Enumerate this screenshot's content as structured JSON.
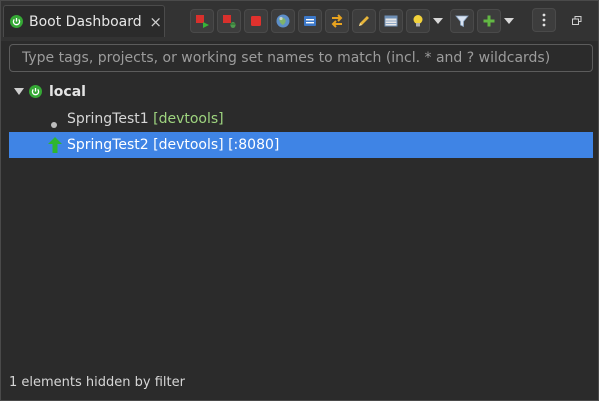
{
  "view": {
    "title": "Boot Dashboard",
    "close_glyph": "×"
  },
  "toolbar": {
    "buttons": [
      {
        "name": "start-button",
        "icon": "start-icon"
      },
      {
        "name": "debug-button",
        "icon": "debug-icon"
      },
      {
        "name": "stop-button",
        "icon": "stop-icon"
      },
      {
        "name": "open-browser-button",
        "icon": "globe-icon"
      },
      {
        "name": "open-console-button",
        "icon": "console-icon"
      },
      {
        "name": "refresh-button",
        "icon": "refresh-arrows-icon"
      },
      {
        "name": "edit-button",
        "icon": "pencil-icon"
      },
      {
        "name": "properties-button",
        "icon": "table-icon"
      },
      {
        "name": "live-hover-button",
        "icon": "lightbulb-icon"
      },
      {
        "name": "filter-button",
        "icon": "funnel-icon"
      },
      {
        "name": "add-target-button",
        "icon": "plus-icon"
      }
    ],
    "menu_icon": "vertical-dots-icon",
    "restore_icon": "restore-window-icon"
  },
  "filter": {
    "placeholder": "Type tags, projects, or working set names to match (incl. * and ? wildcards)",
    "value": ""
  },
  "tree": {
    "group": {
      "label": "local",
      "expanded": true
    },
    "items": [
      {
        "name": "SpringTest1",
        "tags": "[devtools]",
        "port": "",
        "status": "stopped",
        "selected": false
      },
      {
        "name": "SpringTest2",
        "tags": "[devtools]",
        "port": "[:8080]",
        "status": "running",
        "selected": true
      }
    ]
  },
  "status": {
    "text": "1 elements hidden by filter"
  },
  "colors": {
    "selection": "#3f84e5",
    "tag_green": "#9ed47f",
    "running_green": "#2fb62f",
    "stop_red": "#e0312d"
  }
}
